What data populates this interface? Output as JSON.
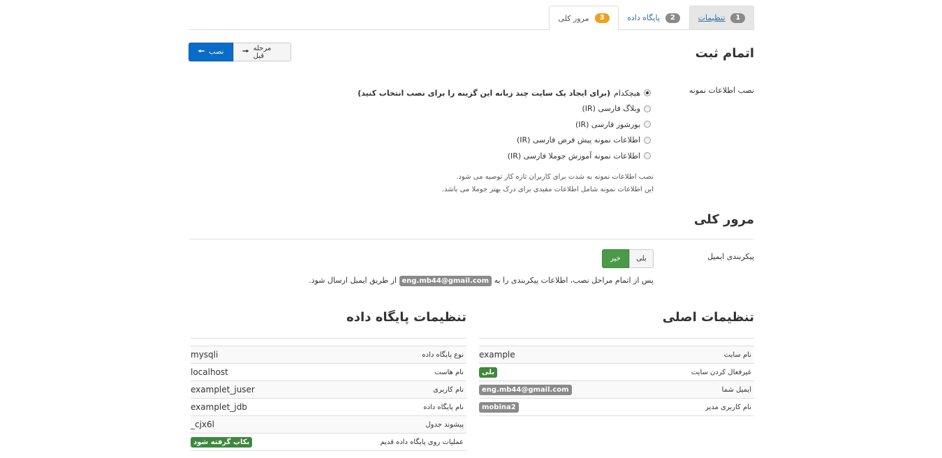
{
  "tabs": [
    {
      "num": "1",
      "label": "تنظیمات"
    },
    {
      "num": "2",
      "label": "پایگاه داده"
    },
    {
      "num": "3",
      "label": "مرور کلی"
    }
  ],
  "actions": {
    "install_label": "نصب",
    "back_label": "مرحله قبل"
  },
  "finish": {
    "title": "اتمام ثبت",
    "sample_label": "نصب اطلاعات نمونه",
    "options": [
      {
        "text": "هیچکدام",
        "bold": "(برای ایجاد یک سایت چند زبانه این گزینه را برای نصب انتخاب کنید)",
        "selected": true
      },
      {
        "text": "وبلاگ فارسی (IR)",
        "bold": "",
        "selected": false
      },
      {
        "text": "بورشور فارسی (IR)",
        "bold": "",
        "selected": false
      },
      {
        "text": "اطلاعات نمونه پیش فرض فارسی (IR)",
        "bold": "",
        "selected": false
      },
      {
        "text": "اطلاعات نمونه آموزش جوملا فارسی (IR)",
        "bold": "",
        "selected": false
      }
    ],
    "help_line1": "نصب اطلاعات نمونه به شدت برای کاربران تازه کار توصیه می شود.",
    "help_line2": "این اطلاعات نمونه شامل اطلاعات مفیدی برای درک بهتر جوملا می باشد."
  },
  "overview": {
    "title": "مرور کلی",
    "email_label": "پیکربندی ایمیل",
    "yes_label": "بلی",
    "no_label": "خیر",
    "note_before": "پس از اتمام مراحل نصب، اطلاعات پیکربندی را به",
    "note_email": "eng.mb44@gmail.com",
    "note_after": "از طریق ایمیل ارسال شود."
  },
  "main_settings": {
    "title": "تنظیمات اصلی",
    "rows": [
      {
        "key": "نام سایت",
        "value": "example",
        "badge": ""
      },
      {
        "key": "غیرفعال کردن سایت",
        "value": "بلی",
        "badge": "green"
      },
      {
        "key": "ایمیل شما",
        "value": "eng.mb44@gmail.com",
        "badge": "gray"
      },
      {
        "key": "نام کاربری مدیر",
        "value": "mobina2",
        "badge": "gray"
      }
    ]
  },
  "db_settings": {
    "title": "تنظیمات پایگاه داده",
    "rows": [
      {
        "key": "نوع پایگاه داده",
        "value": "mysqli",
        "badge": ""
      },
      {
        "key": "نام هاست",
        "value": "localhost",
        "badge": ""
      },
      {
        "key": "نام کاربری",
        "value": "examplet_juser",
        "badge": ""
      },
      {
        "key": "نام پایگاه داده",
        "value": "examplet_jdb",
        "badge": ""
      },
      {
        "key": "پیشوند جدول",
        "value": "cjx6l_",
        "badge": ""
      },
      {
        "key": "عملیات روی پایگاه داده قدیم",
        "value": "بکاپ گرفته شود",
        "badge": "green"
      }
    ]
  }
}
